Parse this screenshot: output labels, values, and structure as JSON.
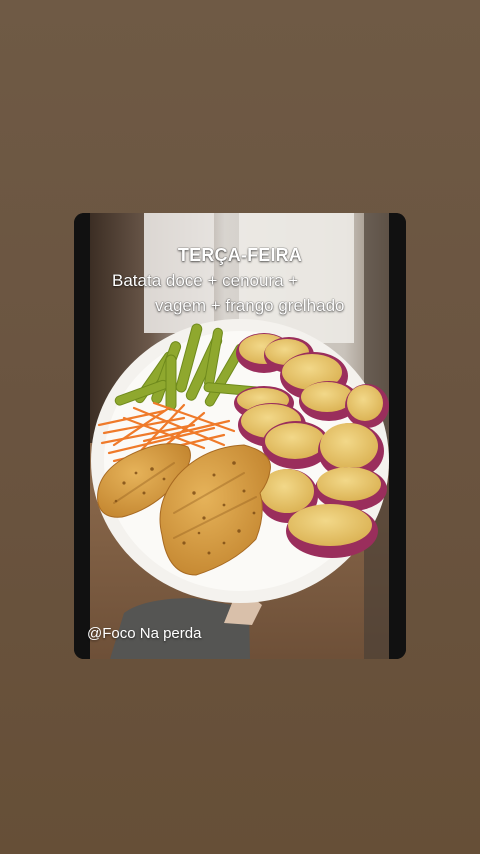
{
  "post": {
    "title": "TERÇA-FEIRA",
    "menu_line_1": "Batata doce + cenoura +",
    "menu_line_2": "vagem + frango grelhado",
    "handle": "@Foco Na perda"
  },
  "colors": {
    "background": "#6b5540",
    "plate": "#f4f2ee",
    "sweet_potato_skin": "#9a2e5c",
    "sweet_potato_flesh": "#e8c766",
    "carrot": "#ef7a2a",
    "green_beans": "#8fa82e",
    "chicken": "#d79a3c"
  }
}
